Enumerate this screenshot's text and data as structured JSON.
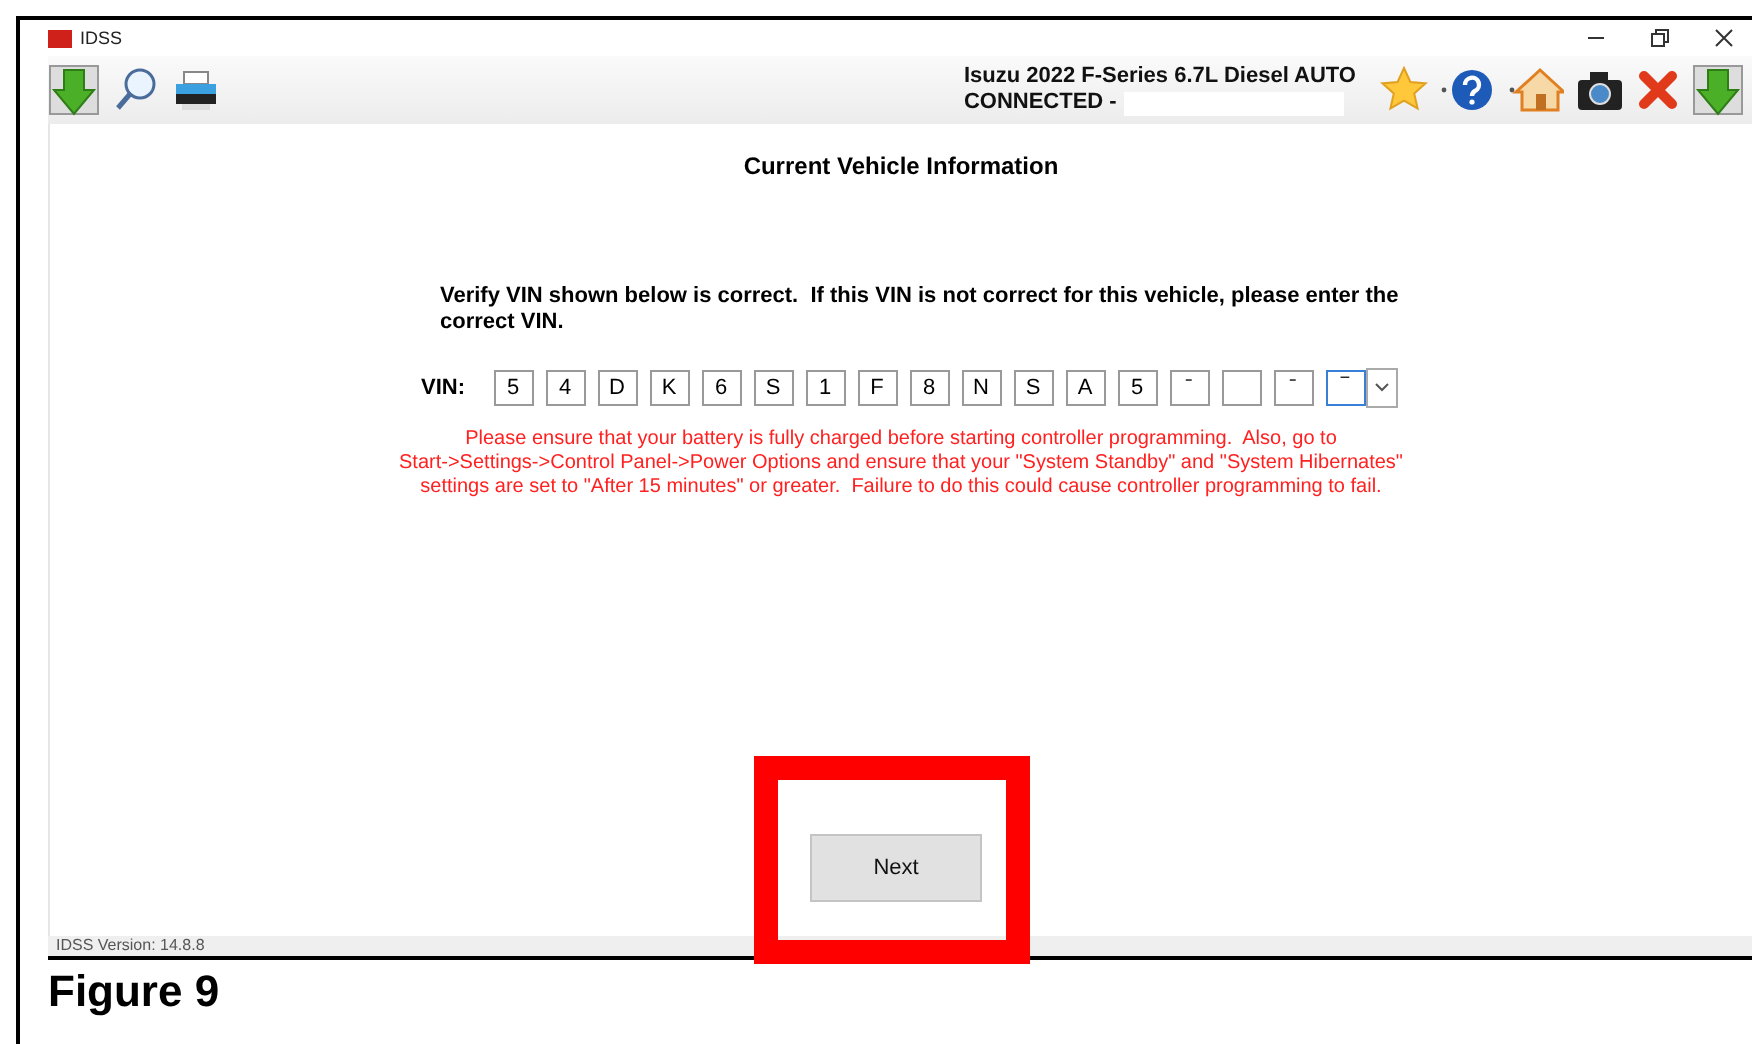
{
  "window": {
    "title": "IDSS"
  },
  "vehicle": {
    "name": "Isuzu 2022 F-Series 6.7L Diesel AUTO",
    "connection": "CONNECTED -"
  },
  "page": {
    "heading": "Current Vehicle Information",
    "instruction": "Verify VIN shown below is correct.  If this VIN is not correct for this vehicle, please enter the correct VIN.",
    "vin_label": "VIN:",
    "vin_boxes": [
      {
        "value": "5",
        "selected": false
      },
      {
        "value": "4",
        "selected": false
      },
      {
        "value": "D",
        "selected": false
      },
      {
        "value": "K",
        "selected": false
      },
      {
        "value": "6",
        "selected": false
      },
      {
        "value": "S",
        "selected": false
      },
      {
        "value": "1",
        "selected": false
      },
      {
        "value": "F",
        "selected": false
      },
      {
        "value": "8",
        "selected": false
      },
      {
        "value": "N",
        "selected": false
      },
      {
        "value": "S",
        "selected": false
      },
      {
        "value": "A",
        "selected": false
      },
      {
        "value": "5",
        "selected": false
      },
      {
        "value": "ˉ",
        "selected": false
      },
      {
        "selected": false
      },
      {
        "value": "ˉ",
        "selected": false
      },
      {
        "value": "‾",
        "selected": true
      }
    ],
    "warning_lines": [
      "Please ensure that your battery is fully charged before starting controller programming.  Also, go to",
      "Start->Settings->Control Panel->Power Options and ensure that your \"System Standby\" and \"System Hibernates\"",
      "settings are set to \"After 15 minutes\" or greater.  Failure to do this could cause controller programming to fail."
    ],
    "next_button": {
      "label": "Next",
      "highlighted": true
    }
  },
  "status_bar": {
    "version": "IDSS Version: 14.8.8"
  },
  "caption": "Figure 9"
}
